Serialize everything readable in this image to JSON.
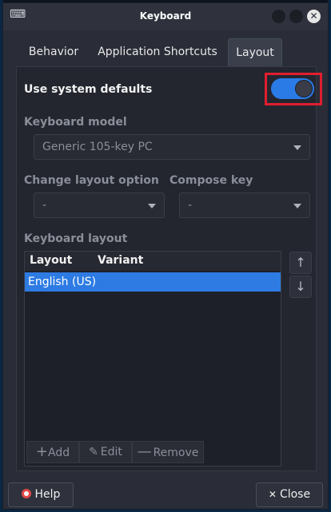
{
  "window": {
    "title": "Keyboard"
  },
  "tabs": [
    {
      "label": "Behavior"
    },
    {
      "label": "Application Shortcuts"
    },
    {
      "label": "Layout"
    }
  ],
  "layout": {
    "use_system_defaults_label": "Use system defaults",
    "use_system_defaults_on": true,
    "keyboard_model_label": "Keyboard model",
    "keyboard_model_value": "Generic 105-key PC",
    "change_layout_option_label": "Change layout option",
    "change_layout_option_value": "-",
    "compose_key_label": "Compose key",
    "compose_key_value": "-",
    "keyboard_layout_label": "Keyboard layout",
    "columns": [
      "Layout",
      "Variant"
    ],
    "rows": [
      {
        "layout": "English (US)",
        "variant": ""
      }
    ],
    "move_up_icon": "arrow-up-icon",
    "move_down_icon": "arrow-down-icon",
    "add_label": "Add",
    "edit_label": "Edit",
    "remove_label": "Remove"
  },
  "footer": {
    "help_label": "Help",
    "close_label": "Close"
  },
  "colors": {
    "accent": "#2b7be6",
    "highlight_box": "#e01e2f"
  }
}
